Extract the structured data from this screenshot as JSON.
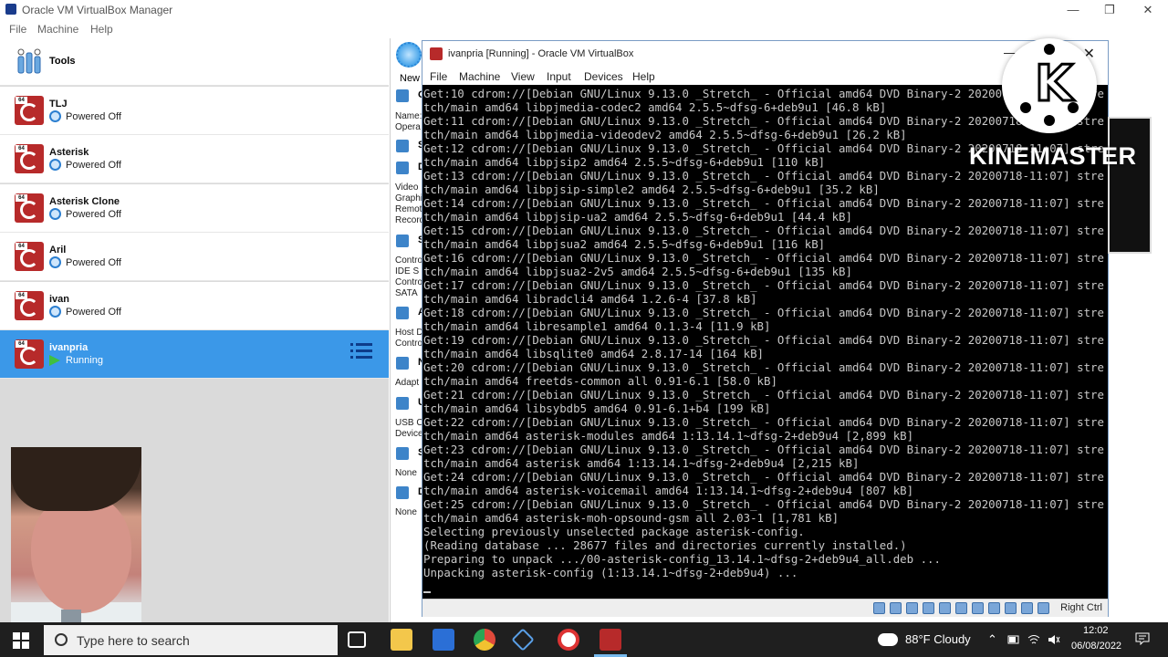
{
  "manager": {
    "title": "Oracle VM VirtualBox Manager",
    "menu": [
      "File",
      "Machine",
      "Help"
    ],
    "tools_label": "Tools",
    "vms": [
      {
        "name": "TLJ",
        "status": "Powered Off"
      },
      {
        "name": "Asterisk",
        "status": "Powered Off"
      },
      {
        "name": "Asterisk Clone",
        "status": "Powered Off"
      },
      {
        "name": "Aril",
        "status": "Powered Off"
      },
      {
        "name": "ivan",
        "status": "Powered Off"
      },
      {
        "name": "ivanpria",
        "status": "Running"
      }
    ],
    "selected_vm": "ivanpria",
    "new_label": "New",
    "details_fragments": [
      {
        "letter": "G",
        "lines": [
          "Name:",
          "Opera"
        ]
      },
      {
        "letter": "S",
        "lines": []
      },
      {
        "letter": "D",
        "lines": [
          "Video",
          "Graphi",
          "Remot",
          "Record"
        ]
      },
      {
        "letter": "S",
        "lines": [
          "Contro",
          "IDE S",
          "Contro",
          "SATA"
        ]
      },
      {
        "letter": "A",
        "lines": [
          "Host D",
          "Contro"
        ]
      },
      {
        "letter": "N",
        "lines": [
          "Adapt"
        ]
      },
      {
        "letter": "U",
        "lines": [
          "USB C",
          "Device"
        ]
      },
      {
        "letter": "S",
        "lines": [
          "None"
        ]
      },
      {
        "letter": "D",
        "lines": [
          "None"
        ]
      }
    ]
  },
  "vm_window": {
    "title": "ivanpria [Running] - Oracle VM VirtualBox",
    "menu": [
      "File",
      "Machine",
      "View",
      "Input",
      "Devices",
      "Help"
    ],
    "host_key": "Right Ctrl"
  },
  "terminal": {
    "lines": [
      "Get:10 cdrom://[Debian GNU/Linux 9.13.0 _Stretch_ - Official amd64 DVD Binary-2 20200718-11:07] stre",
      "tch/main amd64 libpjmedia-codec2 amd64 2.5.5~dfsg-6+deb9u1 [46.8 kB]",
      "Get:11 cdrom://[Debian GNU/Linux 9.13.0 _Stretch_ - Official amd64 DVD Binary-2 20200718-11:07] stre",
      "tch/main amd64 libpjmedia-videodev2 amd64 2.5.5~dfsg-6+deb9u1 [26.2 kB]",
      "Get:12 cdrom://[Debian GNU/Linux 9.13.0 _Stretch_ - Official amd64 DVD Binary-2 20200718-11:07] stre",
      "tch/main amd64 libpjsip2 amd64 2.5.5~dfsg-6+deb9u1 [110 kB]",
      "Get:13 cdrom://[Debian GNU/Linux 9.13.0 _Stretch_ - Official amd64 DVD Binary-2 20200718-11:07] stre",
      "tch/main amd64 libpjsip-simple2 amd64 2.5.5~dfsg-6+deb9u1 [35.2 kB]",
      "Get:14 cdrom://[Debian GNU/Linux 9.13.0 _Stretch_ - Official amd64 DVD Binary-2 20200718-11:07] stre",
      "tch/main amd64 libpjsip-ua2 amd64 2.5.5~dfsg-6+deb9u1 [44.4 kB]",
      "Get:15 cdrom://[Debian GNU/Linux 9.13.0 _Stretch_ - Official amd64 DVD Binary-2 20200718-11:07] stre",
      "tch/main amd64 libpjsua2 amd64 2.5.5~dfsg-6+deb9u1 [116 kB]",
      "Get:16 cdrom://[Debian GNU/Linux 9.13.0 _Stretch_ - Official amd64 DVD Binary-2 20200718-11:07] stre",
      "tch/main amd64 libpjsua2-2v5 amd64 2.5.5~dfsg-6+deb9u1 [135 kB]",
      "Get:17 cdrom://[Debian GNU/Linux 9.13.0 _Stretch_ - Official amd64 DVD Binary-2 20200718-11:07] stre",
      "tch/main amd64 libradcli4 amd64 1.2.6-4 [37.8 kB]",
      "Get:18 cdrom://[Debian GNU/Linux 9.13.0 _Stretch_ - Official amd64 DVD Binary-2 20200718-11:07] stre",
      "tch/main amd64 libresample1 amd64 0.1.3-4 [11.9 kB]",
      "Get:19 cdrom://[Debian GNU/Linux 9.13.0 _Stretch_ - Official amd64 DVD Binary-2 20200718-11:07] stre",
      "tch/main amd64 libsqlite0 amd64 2.8.17-14 [164 kB]",
      "Get:20 cdrom://[Debian GNU/Linux 9.13.0 _Stretch_ - Official amd64 DVD Binary-2 20200718-11:07] stre",
      "tch/main amd64 freetds-common all 0.91-6.1 [58.0 kB]",
      "Get:21 cdrom://[Debian GNU/Linux 9.13.0 _Stretch_ - Official amd64 DVD Binary-2 20200718-11:07] stre",
      "tch/main amd64 libsybdb5 amd64 0.91-6.1+b4 [199 kB]",
      "Get:22 cdrom://[Debian GNU/Linux 9.13.0 _Stretch_ - Official amd64 DVD Binary-2 20200718-11:07] stre",
      "tch/main amd64 asterisk-modules amd64 1:13.14.1~dfsg-2+deb9u4 [2,899 kB]",
      "Get:23 cdrom://[Debian GNU/Linux 9.13.0 _Stretch_ - Official amd64 DVD Binary-2 20200718-11:07] stre",
      "tch/main amd64 asterisk amd64 1:13.14.1~dfsg-2+deb9u4 [2,215 kB]",
      "Get:24 cdrom://[Debian GNU/Linux 9.13.0 _Stretch_ - Official amd64 DVD Binary-2 20200718-11:07] stre",
      "tch/main amd64 asterisk-voicemail amd64 1:13.14.1~dfsg-2+deb9u4 [807 kB]",
      "Get:25 cdrom://[Debian GNU/Linux 9.13.0 _Stretch_ - Official amd64 DVD Binary-2 20200718-11:07] stre",
      "tch/main amd64 asterisk-moh-opsound-gsm all 2.03-1 [1,781 kB]",
      "Selecting previously unselected package asterisk-config.",
      "(Reading database ... 28677 files and directories currently installed.)",
      "Preparing to unpack .../00-asterisk-config_13.14.1~dfsg-2+deb9u4_all.deb ...",
      "Unpacking asterisk-config (1:13.14.1~dfsg-2+deb9u4) ..."
    ]
  },
  "watermark": {
    "word": "KINEMASTER",
    "letter": "K"
  },
  "taskbar": {
    "search_placeholder": "Type here to search",
    "weather": "88°F  Cloudy",
    "time": "12:02",
    "date": "06/08/2022"
  }
}
